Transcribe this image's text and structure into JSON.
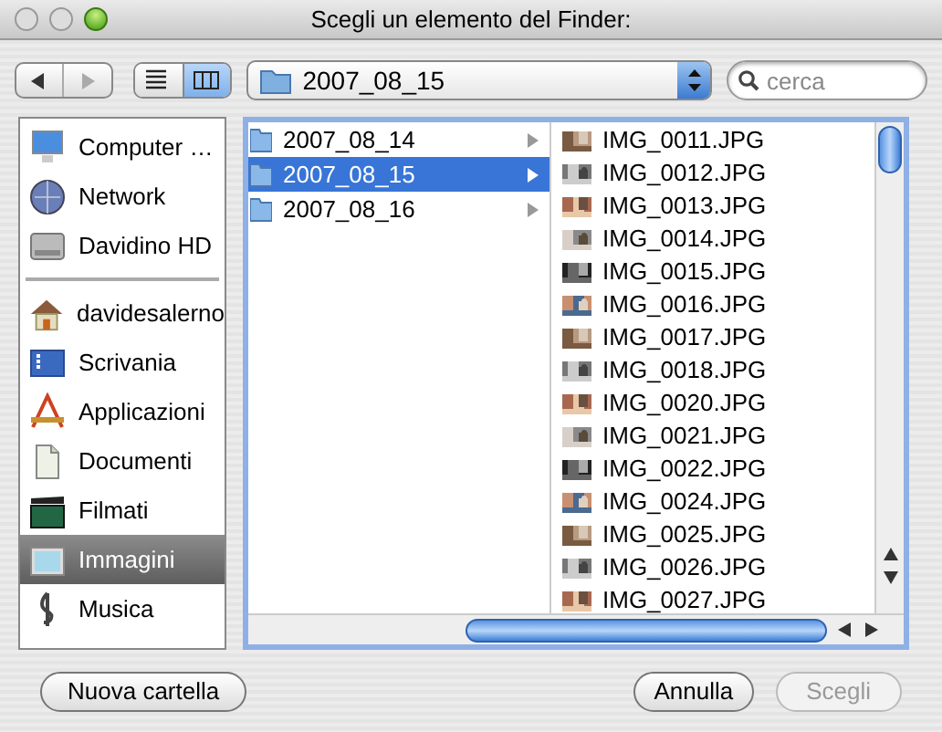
{
  "window": {
    "title": "Scegli un elemento del Finder:"
  },
  "toolbar": {
    "back": {
      "disabled": false
    },
    "forward": {
      "disabled": true
    },
    "views": [
      {
        "kind": "list",
        "selected": false
      },
      {
        "kind": "columns",
        "selected": true
      }
    ],
    "path_popup": {
      "value": "2007_08_15"
    },
    "search": {
      "placeholder": "cerca"
    }
  },
  "sidebar": {
    "items": [
      {
        "label": "Computer …",
        "kind": "computer",
        "selected": false
      },
      {
        "label": "Network",
        "kind": "network",
        "selected": false
      },
      {
        "label": "Davidino HD",
        "kind": "disk",
        "selected": false
      },
      {
        "label": "davidesalerno",
        "kind": "home",
        "selected": false
      },
      {
        "label": "Scrivania",
        "kind": "desktop",
        "selected": false
      },
      {
        "label": "Applicazioni",
        "kind": "apps",
        "selected": false
      },
      {
        "label": "Documenti",
        "kind": "docs",
        "selected": false
      },
      {
        "label": "Filmati",
        "kind": "movies",
        "selected": false
      },
      {
        "label": "Immagini",
        "kind": "pictures",
        "selected": true
      },
      {
        "label": "Musica",
        "kind": "music",
        "selected": false
      }
    ]
  },
  "browser": {
    "folders": [
      {
        "name": "2007_08_14",
        "selected": false
      },
      {
        "name": "2007_08_15",
        "selected": true
      },
      {
        "name": "2007_08_16",
        "selected": false
      }
    ],
    "files": [
      {
        "name": "IMG_0011.JPG",
        "selected": false
      },
      {
        "name": "IMG_0012.JPG",
        "selected": false
      },
      {
        "name": "IMG_0013.JPG",
        "selected": false
      },
      {
        "name": "IMG_0014.JPG",
        "selected": false
      },
      {
        "name": "IMG_0015.JPG",
        "selected": false
      },
      {
        "name": "IMG_0016.JPG",
        "selected": false
      },
      {
        "name": "IMG_0017.JPG",
        "selected": false
      },
      {
        "name": "IMG_0018.JPG",
        "selected": false
      },
      {
        "name": "IMG_0020.JPG",
        "selected": false
      },
      {
        "name": "IMG_0021.JPG",
        "selected": false
      },
      {
        "name": "IMG_0022.JPG",
        "selected": false
      },
      {
        "name": "IMG_0024.JPG",
        "selected": false
      },
      {
        "name": "IMG_0025.JPG",
        "selected": false
      },
      {
        "name": "IMG_0026.JPG",
        "selected": false
      },
      {
        "name": "IMG_0027.JPG",
        "selected": false
      }
    ]
  },
  "buttons": [
    {
      "label": "Nuova cartella",
      "kind": "new_folder",
      "disabled": false
    },
    {
      "label": "Annulla",
      "kind": "cancel",
      "disabled": false
    },
    {
      "label": "Scegli",
      "kind": "choose",
      "disabled": true
    }
  ]
}
